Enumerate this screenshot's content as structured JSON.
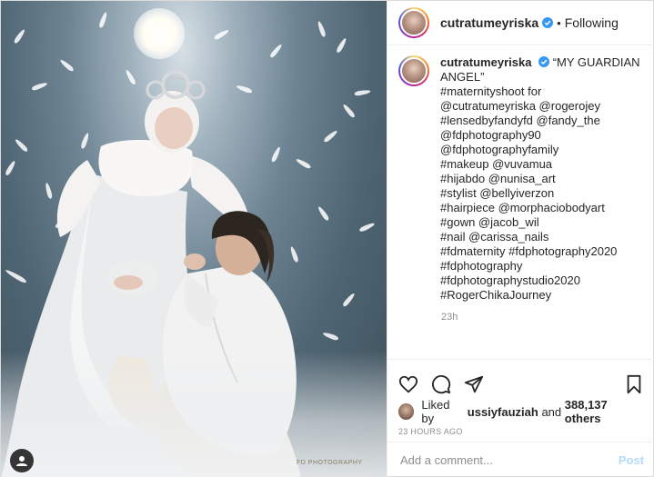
{
  "header": {
    "username": "cutratumeyriska",
    "separator": "•",
    "follow_status": "Following"
  },
  "caption": {
    "username": "cutratumeyriska",
    "lines": [
      "“MY GUARDIAN",
      "ANGEL”",
      "#maternityshoot for",
      "@cutratumeyriska @rogerojey",
      "#lensedbyfandyfd @fandy_the",
      "@fdphotography90",
      "@fdphotographyfamily",
      "#makeup @vuvamua",
      "#hijabdo @nunisa_art",
      "#stylist @bellyiverzon",
      "#hairpiece @morphaciobodyart",
      "#gown @jacob_wil",
      "#nail @carissa_nails",
      "#fdmaternity #fdphotography2020",
      "#fdphotography",
      "#fdphotographystudio2020",
      "#RogerChikaJourney"
    ],
    "time": "23h"
  },
  "likes": {
    "prefix": "Liked by",
    "liker": "ussiyfauziah",
    "middle": "and",
    "others": "388,137 others"
  },
  "posted_ago": "23 HOURS AGO",
  "comment_box": {
    "placeholder": "Add a comment...",
    "post_label": "Post"
  },
  "photo": {
    "watermark": "FD PHOTOGRAPHY"
  },
  "icons": {
    "like": "heart-icon",
    "comment": "comment-icon",
    "share": "share-icon",
    "save": "bookmark-icon",
    "verified": "verified-badge-icon"
  },
  "colors": {
    "accent": "#0095f6",
    "post_disabled": "#b3dbff",
    "muted": "#8e8e8e"
  }
}
